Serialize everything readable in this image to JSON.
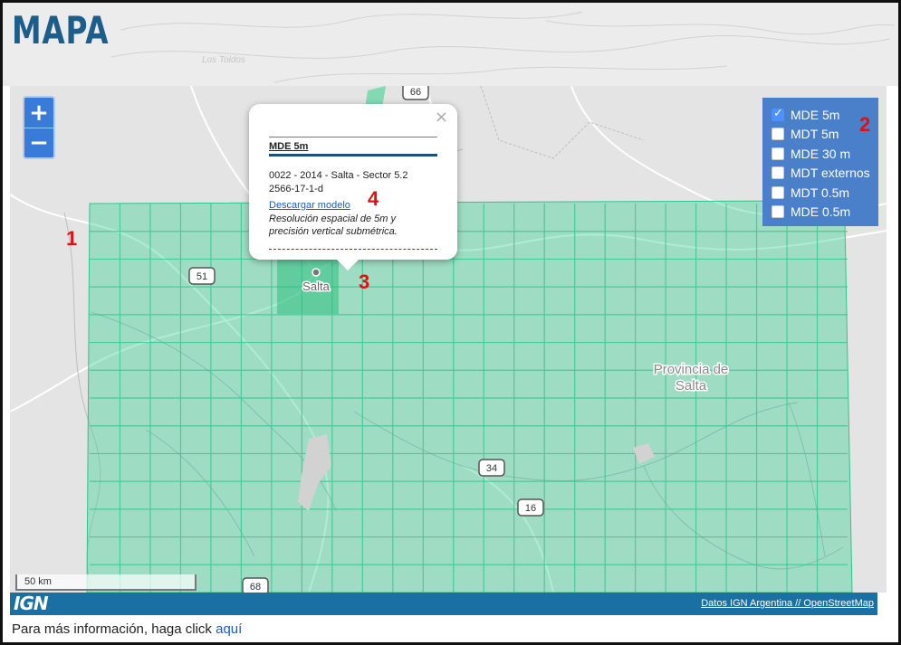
{
  "header": {
    "title": "MAPA"
  },
  "map": {
    "background_color": "#e4e4e4",
    "coverage_color": "#3ed598",
    "place_labels": {
      "city": "Salta",
      "province_line1": "Provincia de",
      "province_line2": "Salta",
      "top_left_faint": "Los Toldos"
    },
    "route_shields": [
      "66",
      "51",
      "34",
      "16",
      "68"
    ],
    "scale_label": "50 km"
  },
  "zoom": {
    "in_label": "+",
    "out_label": "−"
  },
  "layers": [
    {
      "label": "MDE 5m",
      "checked": true
    },
    {
      "label": "MDT 5m",
      "checked": false
    },
    {
      "label": "MDE 30 m",
      "checked": false
    },
    {
      "label": "MDT externos",
      "checked": false
    },
    {
      "label": "MDT 0.5m",
      "checked": false
    },
    {
      "label": "MDE 0.5m",
      "checked": false
    }
  ],
  "popup": {
    "close_label": "×",
    "title": "MDE 5m",
    "line1": "0022 - 2014 - Salta - Sector 5.2",
    "line2": "2566-17-1-d",
    "link_label": "Descargar modelo",
    "description": "Resolución espacial de 5m y precisión vertical submétrica."
  },
  "footer": {
    "logo_text": "IGN",
    "attribution": "Datos IGN Argentina // OpenStreetMap",
    "color": "#1a6fa3"
  },
  "info": {
    "text": "Para más información, haga click ",
    "link": "aquí"
  },
  "annotations": [
    "1",
    "2",
    "3",
    "4"
  ]
}
